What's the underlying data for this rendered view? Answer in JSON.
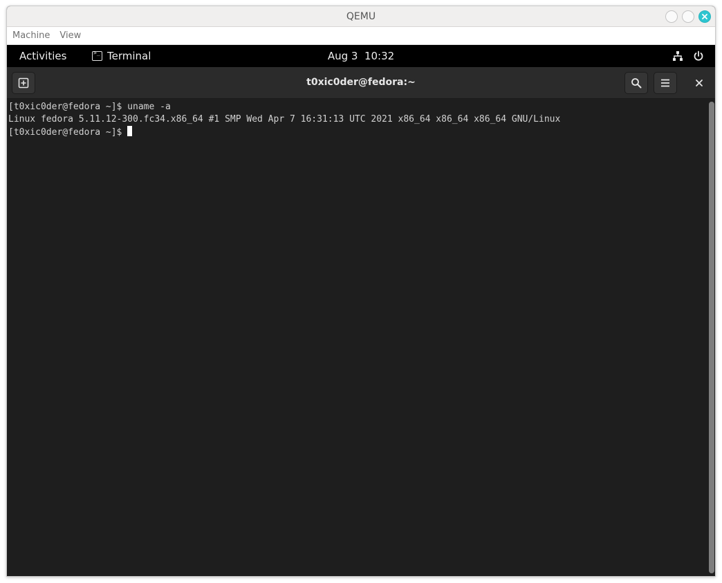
{
  "qemu": {
    "title": "QEMU",
    "menu": [
      "Machine",
      "View"
    ]
  },
  "gnome_topbar": {
    "activities": "Activities",
    "app_name": "Terminal",
    "clock": "Aug 3  10:32",
    "icons": [
      "network-wired-icon",
      "power-icon"
    ]
  },
  "terminal": {
    "title": "t0xic0der@fedora:~",
    "header_icons": [
      "new-tab-icon",
      "search-icon",
      "hamburger-menu-icon",
      "close-icon"
    ],
    "lines": [
      "[t0xic0der@fedora ~]$ uname -a",
      "Linux fedora 5.11.12-300.fc34.x86_64 #1 SMP Wed Apr 7 16:31:13 UTC 2021 x86_64 x86_64 x86_64 GNU/Linux",
      "[t0xic0der@fedora ~]$ "
    ]
  },
  "colors": {
    "accent_close": "#2ec5d0",
    "terminal_bg": "#1e1e1e",
    "topbar_bg": "#000000"
  }
}
